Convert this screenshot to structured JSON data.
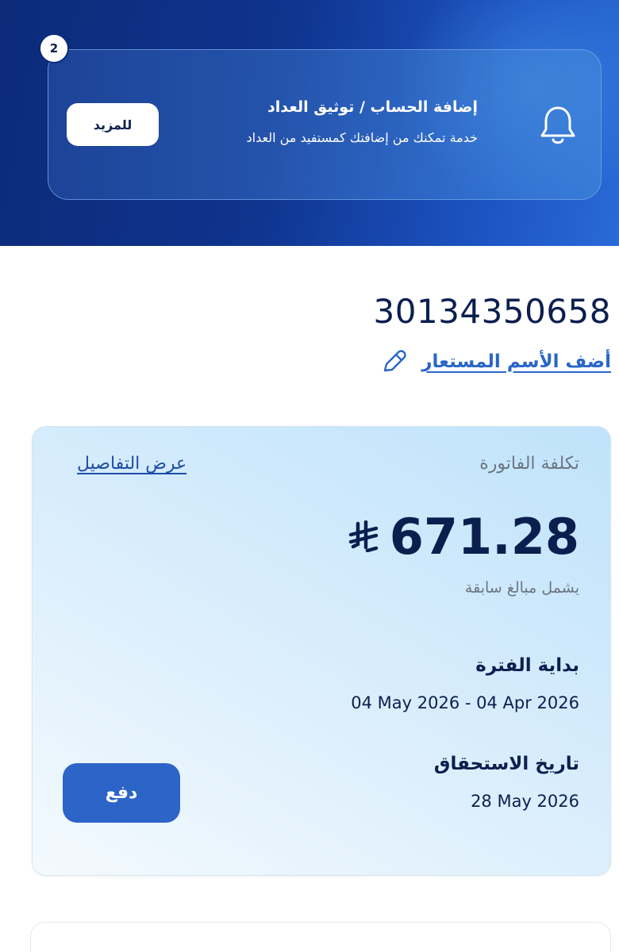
{
  "notification": {
    "step_number": "2",
    "title": "إضافة الحساب / توثيق العداد",
    "description": "خدمة تمكنك من إضافتك كمستفيد من العداد",
    "more_label": "للمزيد",
    "icon": "bell-icon"
  },
  "account": {
    "number": "30134350658",
    "add_alias_label": "أضف الأسم المستعار",
    "edit_icon": "pencil-icon"
  },
  "bill": {
    "cost_label": "تكلفة الفاتورة",
    "details_link": "عرض التفاصيل",
    "amount": "671.28",
    "currency_icon": "riyal-icon",
    "amount_note": "يشمل مبالغ سابقة",
    "period_label": "بداية الفترة",
    "period_value": "04 May 2026 - 04 Apr 2026",
    "due_label": "تاريخ الاستحقاق",
    "due_value": "28 May 2026",
    "pay_label": "دفع"
  },
  "colors": {
    "brand_navy": "#0b1f4f",
    "accent_blue": "#2d64c8",
    "link_blue": "#2a66c8",
    "muted_gray": "#6d7682"
  }
}
